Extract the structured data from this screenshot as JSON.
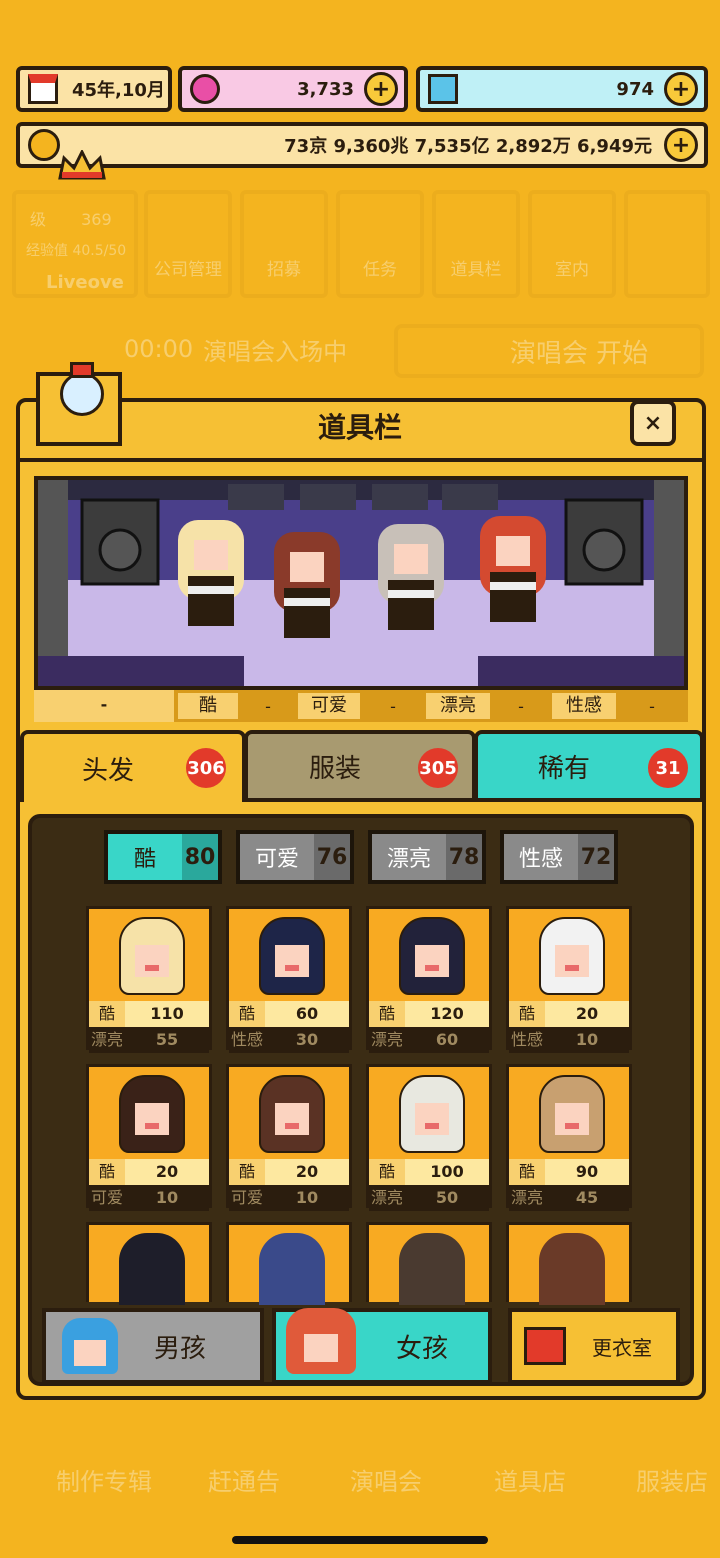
{
  "top": {
    "date": "45年,10月",
    "pink_currency": "3,733",
    "diamond_currency": "974",
    "money": "73京 9,360兆 7,535亿 2,892万 6,949元"
  },
  "profile": {
    "level_label": "级",
    "level_value": "369",
    "exp_label": "经验值 40.5/50",
    "name": "Liveove"
  },
  "menu": [
    "公司管理",
    "招募",
    "任务",
    "道具栏",
    "室内"
  ],
  "concert_bar": {
    "time": "00:00",
    "text": "演唱会入场中",
    "button": "演唱会 开始"
  },
  "panel": {
    "title": "道具栏",
    "close_symbol": "×",
    "attributes": [
      "-",
      "酷",
      "-",
      "可爱",
      "-",
      "漂亮",
      "-",
      "性感",
      "-"
    ],
    "tabs": [
      {
        "label": "头发",
        "count": "306"
      },
      {
        "label": "服装",
        "count": "305"
      },
      {
        "label": "稀有",
        "count": "31"
      }
    ],
    "filters": [
      {
        "label": "酷",
        "count": "80"
      },
      {
        "label": "可爱",
        "count": "76"
      },
      {
        "label": "漂亮",
        "count": "78"
      },
      {
        "label": "性感",
        "count": "72"
      }
    ],
    "items": [
      {
        "k1": "酷",
        "v1": "110",
        "k2": "漂亮",
        "v2": "55",
        "hair": "#f6e2a8"
      },
      {
        "k1": "酷",
        "v1": "60",
        "k2": "性感",
        "v2": "30",
        "hair": "#1e2548"
      },
      {
        "k1": "酷",
        "v1": "120",
        "k2": "漂亮",
        "v2": "60",
        "hair": "#22223a"
      },
      {
        "k1": "酷",
        "v1": "20",
        "k2": "性感",
        "v2": "10",
        "hair": "#f2f2f2"
      },
      {
        "k1": "酷",
        "v1": "20",
        "k2": "可爱",
        "v2": "10",
        "hair": "#3a2218"
      },
      {
        "k1": "酷",
        "v1": "20",
        "k2": "可爱",
        "v2": "10",
        "hair": "#5a3224"
      },
      {
        "k1": "酷",
        "v1": "100",
        "k2": "漂亮",
        "v2": "50",
        "hair": "#e8e8e0"
      },
      {
        "k1": "酷",
        "v1": "90",
        "k2": "漂亮",
        "v2": "45",
        "hair": "#c8a070"
      }
    ],
    "bottom": {
      "boy": "男孩",
      "girl": "女孩",
      "closet": "更衣室"
    }
  },
  "nav": [
    "制作专辑",
    "赶通告",
    "演唱会",
    "道具店",
    "服装店"
  ],
  "colors": {
    "bg": "#f4b41f",
    "accent": "#39d6c8",
    "dark": "#2b1d0e",
    "red": "#e23a2a"
  }
}
